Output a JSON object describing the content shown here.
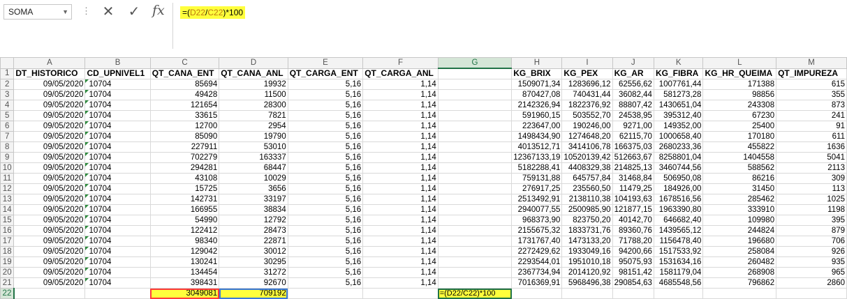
{
  "name_box": "SOMA",
  "formula": {
    "prefix": "=(",
    "ref1": "D22",
    "slash": "/",
    "ref2": "C22",
    "suffix": ")*100"
  },
  "columns": [
    "A",
    "B",
    "C",
    "D",
    "E",
    "F",
    "G",
    "H",
    "I",
    "J",
    "K",
    "L",
    "M"
  ],
  "selected_column": "G",
  "header_row": [
    "DT_HISTORICO",
    "CD_UPNIVEL1",
    "QT_CANA_ENT",
    "QT_CANA_ANL",
    "QT_CARGA_ENT",
    "QT_CARGA_ANL",
    "",
    "KG_BRIX",
    "KG_PEX",
    "KG_AR",
    "KG_FIBRA",
    "KG_HR_QUEIMA",
    "QT_IMPUREZA"
  ],
  "rows": [
    {
      "n": "2",
      "c": [
        "09/05/2020",
        "10704",
        "85694",
        "19932",
        "5,16",
        "1,14",
        "",
        "1509071,34",
        "1283696,12",
        "62556,62",
        "1007761,44",
        "171388",
        "615"
      ]
    },
    {
      "n": "3",
      "c": [
        "09/05/2020",
        "10704",
        "49428",
        "11500",
        "5,16",
        "1,14",
        "",
        "870427,08",
        "740431,44",
        "36082,44",
        "581273,28",
        "98856",
        "355"
      ]
    },
    {
      "n": "4",
      "c": [
        "09/05/2020",
        "10704",
        "121654",
        "28300",
        "5,16",
        "1,14",
        "",
        "2142326,94",
        "1822376,92",
        "88807,42",
        "1430651,04",
        "243308",
        "873"
      ]
    },
    {
      "n": "5",
      "c": [
        "09/05/2020",
        "10704",
        "33615",
        "7821",
        "5,16",
        "1,14",
        "",
        "591960,15",
        "503552,70",
        "24538,95",
        "395312,40",
        "67230",
        "241"
      ]
    },
    {
      "n": "6",
      "c": [
        "09/05/2020",
        "10704",
        "12700",
        "2954",
        "5,16",
        "1,14",
        "",
        "223647,00",
        "190246,00",
        "9271,00",
        "149352,00",
        "25400",
        "91"
      ]
    },
    {
      "n": "7",
      "c": [
        "09/05/2020",
        "10704",
        "85090",
        "19790",
        "5,16",
        "1,14",
        "",
        "1498434,90",
        "1274648,20",
        "62115,70",
        "1000658,40",
        "170180",
        "611"
      ]
    },
    {
      "n": "8",
      "c": [
        "09/05/2020",
        "10704",
        "227911",
        "53010",
        "5,16",
        "1,14",
        "",
        "4013512,71",
        "3414106,78",
        "166375,03",
        "2680233,36",
        "455822",
        "1636"
      ]
    },
    {
      "n": "9",
      "c": [
        "09/05/2020",
        "10704",
        "702279",
        "163337",
        "5,16",
        "1,14",
        "",
        "12367133,19",
        "10520139,42",
        "512663,67",
        "8258801,04",
        "1404558",
        "5041"
      ]
    },
    {
      "n": "10",
      "c": [
        "09/05/2020",
        "10704",
        "294281",
        "68447",
        "5,16",
        "1,14",
        "",
        "5182288,41",
        "4408329,38",
        "214825,13",
        "3460744,56",
        "588562",
        "2113"
      ]
    },
    {
      "n": "11",
      "c": [
        "09/05/2020",
        "10704",
        "43108",
        "10029",
        "5,16",
        "1,14",
        "",
        "759131,88",
        "645757,84",
        "31468,84",
        "506950,08",
        "86216",
        "309"
      ]
    },
    {
      "n": "12",
      "c": [
        "09/05/2020",
        "10704",
        "15725",
        "3656",
        "5,16",
        "1,14",
        "",
        "276917,25",
        "235560,50",
        "11479,25",
        "184926,00",
        "31450",
        "113"
      ]
    },
    {
      "n": "13",
      "c": [
        "09/05/2020",
        "10704",
        "142731",
        "33197",
        "5,16",
        "1,14",
        "",
        "2513492,91",
        "2138110,38",
        "104193,63",
        "1678516,56",
        "285462",
        "1025"
      ]
    },
    {
      "n": "14",
      "c": [
        "09/05/2020",
        "10704",
        "166955",
        "38834",
        "5,16",
        "1,14",
        "",
        "2940077,55",
        "2500985,90",
        "121877,15",
        "1963390,80",
        "333910",
        "1198"
      ]
    },
    {
      "n": "15",
      "c": [
        "09/05/2020",
        "10704",
        "54990",
        "12792",
        "5,16",
        "1,14",
        "",
        "968373,90",
        "823750,20",
        "40142,70",
        "646682,40",
        "109980",
        "395"
      ]
    },
    {
      "n": "16",
      "c": [
        "09/05/2020",
        "10704",
        "122412",
        "28473",
        "5,16",
        "1,14",
        "",
        "2155675,32",
        "1833731,76",
        "89360,76",
        "1439565,12",
        "244824",
        "879"
      ]
    },
    {
      "n": "17",
      "c": [
        "09/05/2020",
        "10704",
        "98340",
        "22871",
        "5,16",
        "1,14",
        "",
        "1731767,40",
        "1473133,20",
        "71788,20",
        "1156478,40",
        "196680",
        "706"
      ]
    },
    {
      "n": "18",
      "c": [
        "09/05/2020",
        "10704",
        "129042",
        "30012",
        "5,16",
        "1,14",
        "",
        "2272429,62",
        "1933049,16",
        "94200,66",
        "1517533,92",
        "258084",
        "926"
      ]
    },
    {
      "n": "19",
      "c": [
        "09/05/2020",
        "10704",
        "130241",
        "30295",
        "5,16",
        "1,14",
        "",
        "2293544,01",
        "1951010,18",
        "95075,93",
        "1531634,16",
        "260482",
        "935"
      ]
    },
    {
      "n": "20",
      "c": [
        "09/05/2020",
        "10704",
        "134454",
        "31272",
        "5,16",
        "1,14",
        "",
        "2367734,94",
        "2014120,92",
        "98151,42",
        "1581179,04",
        "268908",
        "965"
      ]
    },
    {
      "n": "21",
      "c": [
        "09/05/2020",
        "10704",
        "398431",
        "92670",
        "5,16",
        "1,14",
        "",
        "7016369,91",
        "5968496,38",
        "290854,63",
        "4685548,56",
        "796862",
        "2860"
      ]
    }
  ],
  "total_row": {
    "n": "22",
    "c": [
      "",
      "",
      "3049081",
      "709192",
      "",
      "",
      "=(D22/C22)*100",
      "",
      "",
      "",
      "",
      "",
      ""
    ]
  },
  "colors": {
    "highlight": "#ffff3c",
    "accent": "#217346",
    "ref_red": "#ff3b3b",
    "ref_blue": "#3a79d6"
  }
}
